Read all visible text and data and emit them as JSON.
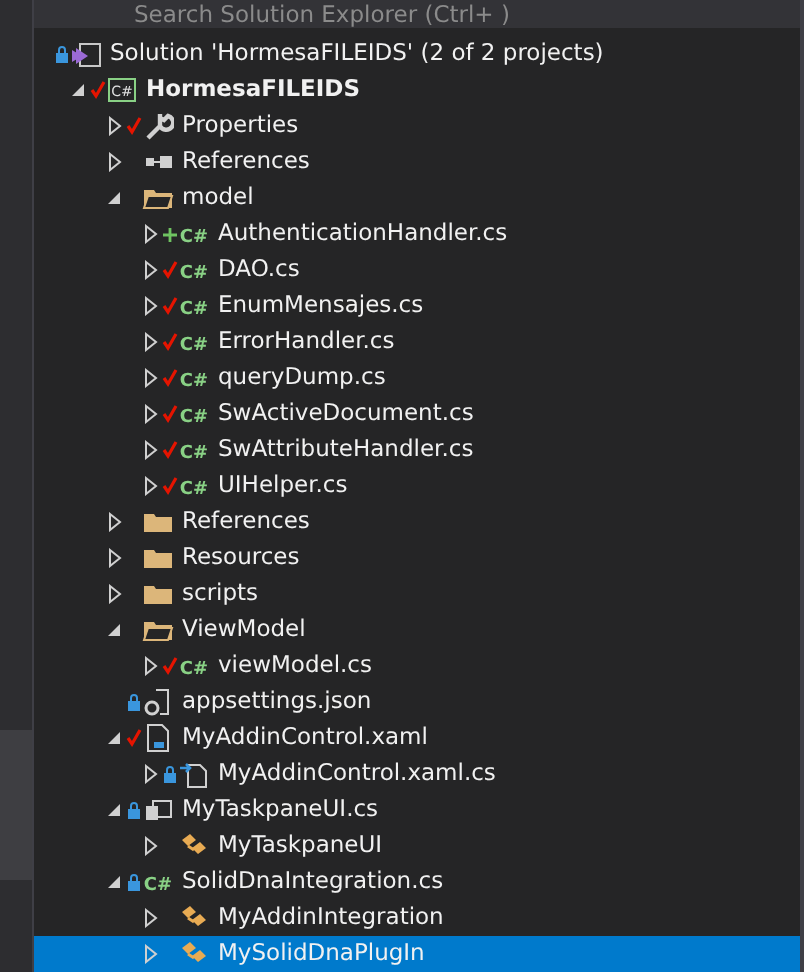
{
  "search": {
    "placeholder": "Search Solution Explorer (Ctrl+ )"
  },
  "tree": [
    {
      "label": "Solution 'HormesaFILEIDS' (2 of 2 projects)",
      "kind": "solution",
      "checked": false,
      "added": false,
      "locked": true,
      "selected": false,
      "children": [
        {
          "label": "HormesaFILEIDS",
          "kind": "project",
          "icon_text": "C#",
          "checked": true,
          "added": false,
          "locked": false,
          "bold": true,
          "expanded": true,
          "selected": false,
          "children": [
            {
              "label": "Properties",
              "kind": "wrench",
              "checked": true,
              "added": false,
              "locked": false,
              "expanded": false,
              "selected": false
            },
            {
              "label": "References",
              "kind": "references",
              "checked": false,
              "added": false,
              "locked": false,
              "expanded": false,
              "selected": false
            },
            {
              "label": "model",
              "kind": "folder",
              "checked": false,
              "added": false,
              "locked": false,
              "expanded": true,
              "selected": false,
              "children": [
                {
                  "label": "AuthenticationHandler.cs",
                  "kind": "code",
                  "icon_text": "C#",
                  "checked": false,
                  "added": true,
                  "locked": false,
                  "expanded": false,
                  "selected": false
                },
                {
                  "label": "DAO.cs",
                  "kind": "code",
                  "icon_text": "C#",
                  "checked": true,
                  "added": false,
                  "locked": false,
                  "expanded": false,
                  "selected": false
                },
                {
                  "label": "EnumMensajes.cs",
                  "kind": "code",
                  "icon_text": "C#",
                  "checked": true,
                  "added": false,
                  "locked": false,
                  "expanded": false,
                  "selected": false
                },
                {
                  "label": "ErrorHandler.cs",
                  "kind": "code",
                  "icon_text": "C#",
                  "checked": true,
                  "added": false,
                  "locked": false,
                  "expanded": false,
                  "selected": false
                },
                {
                  "label": "queryDump.cs",
                  "kind": "code",
                  "icon_text": "C#",
                  "checked": true,
                  "added": false,
                  "locked": false,
                  "expanded": false,
                  "selected": false
                },
                {
                  "label": "SwActiveDocument.cs",
                  "kind": "code",
                  "icon_text": "C#",
                  "checked": true,
                  "added": false,
                  "locked": false,
                  "expanded": false,
                  "selected": false
                },
                {
                  "label": "SwAttributeHandler.cs",
                  "kind": "code",
                  "icon_text": "C#",
                  "checked": true,
                  "added": false,
                  "locked": false,
                  "expanded": false,
                  "selected": false
                },
                {
                  "label": "UIHelper.cs",
                  "kind": "code",
                  "icon_text": "C#",
                  "checked": true,
                  "added": false,
                  "locked": false,
                  "expanded": false,
                  "selected": false
                }
              ]
            },
            {
              "label": "References",
              "kind": "folder",
              "checked": false,
              "added": false,
              "locked": false,
              "expanded": false,
              "selected": false
            },
            {
              "label": "Resources",
              "kind": "folder",
              "checked": false,
              "added": false,
              "locked": false,
              "expanded": false,
              "selected": false
            },
            {
              "label": "scripts",
              "kind": "folder",
              "checked": false,
              "added": false,
              "locked": false,
              "expanded": false,
              "selected": false
            },
            {
              "label": "ViewModel",
              "kind": "folder",
              "checked": false,
              "added": false,
              "locked": false,
              "expanded": true,
              "selected": false,
              "children": [
                {
                  "label": "viewModel.cs",
                  "kind": "code",
                  "icon_text": "C#",
                  "checked": true,
                  "added": false,
                  "locked": false,
                  "expanded": false,
                  "selected": false
                }
              ]
            },
            {
              "label": "appsettings.json",
              "kind": "settings",
              "checked": false,
              "added": false,
              "locked": true,
              "selected": false
            },
            {
              "label": "MyAddinControl.xaml",
              "kind": "xaml",
              "checked": true,
              "added": false,
              "locked": false,
              "expanded": true,
              "selected": false,
              "children": [
                {
                  "label": "MyAddinControl.xaml.cs",
                  "kind": "codebehind",
                  "checked": false,
                  "added": false,
                  "locked": true,
                  "expanded": false,
                  "selected": false
                }
              ]
            },
            {
              "label": "MyTaskpaneUI.cs",
              "kind": "form",
              "checked": false,
              "added": false,
              "locked": true,
              "expanded": true,
              "selected": false,
              "children": [
                {
                  "label": "MyTaskpaneUI",
                  "kind": "class",
                  "checked": false,
                  "added": false,
                  "locked": false,
                  "expanded": false,
                  "selected": false
                }
              ]
            },
            {
              "label": "SolidDnaIntegration.cs",
              "kind": "code",
              "icon_text": "C#",
              "checked": false,
              "added": false,
              "locked": true,
              "expanded": true,
              "selected": false,
              "children": [
                {
                  "label": "MyAddinIntegration",
                  "kind": "class",
                  "checked": false,
                  "added": false,
                  "locked": false,
                  "expanded": false,
                  "selected": false
                },
                {
                  "label": "MySolidDnaPlugIn",
                  "kind": "class",
                  "checked": false,
                  "added": false,
                  "locked": false,
                  "expanded": false,
                  "selected": true
                }
              ]
            }
          ]
        }
      ]
    }
  ]
}
